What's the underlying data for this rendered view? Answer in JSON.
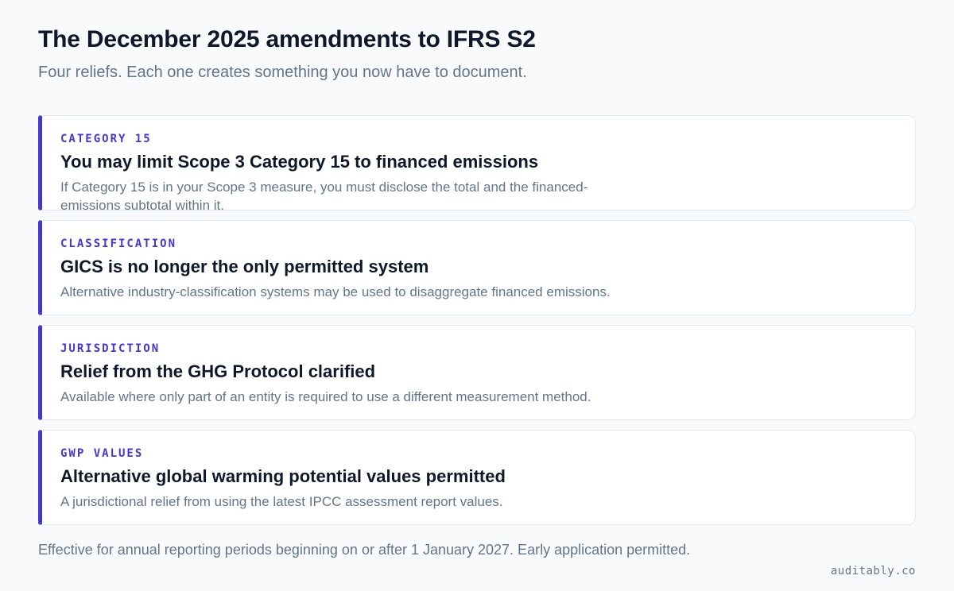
{
  "header": {
    "title": "The December 2025 amendments to IFRS S2",
    "subtitle": "Four reliefs. Each one creates something you now have to document."
  },
  "accent_color": "#4338ca",
  "cards": [
    {
      "tag": "CATEGORY 15",
      "heading": "You may limit Scope 3 Category 15 to financed emissions",
      "body": "If Category 15 is in your Scope 3 measure, you must disclose the total and the financed-emissions subtotal within it."
    },
    {
      "tag": "CLASSIFICATION",
      "heading": "GICS is no longer the only permitted system",
      "body": "Alternative industry-classification systems may be used to disaggregate financed emissions."
    },
    {
      "tag": "JURISDICTION",
      "heading": "Relief from the GHG Protocol clarified",
      "body": "Available where only part of an entity is required to use a different measurement method."
    },
    {
      "tag": "GWP VALUES",
      "heading": "Alternative global warming potential values permitted",
      "body": "A jurisdictional relief from using the latest IPCC assessment report values."
    }
  ],
  "footer": {
    "note": "Effective for annual reporting periods beginning on or after 1 January 2027. Early application permitted.",
    "brand": "auditably.co"
  }
}
